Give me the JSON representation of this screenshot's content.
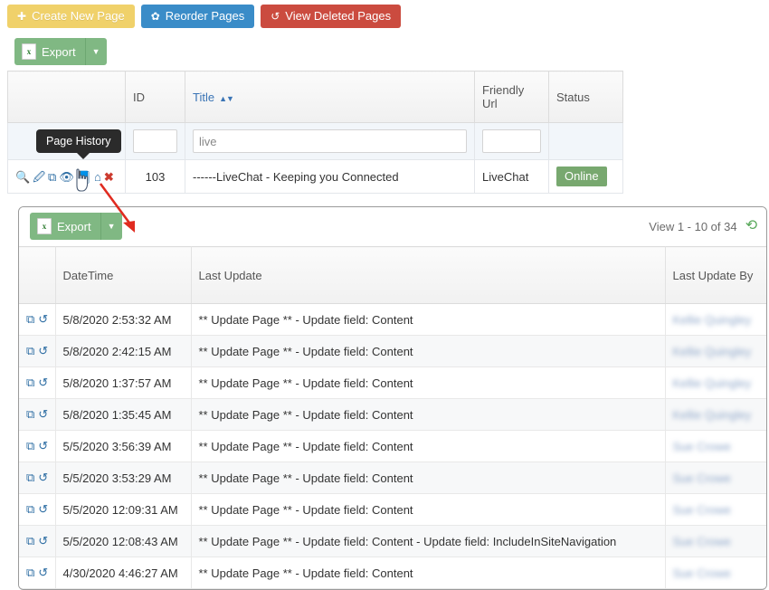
{
  "toolbar": {
    "create_label": "Create New Page",
    "create_icon": "plus-icon",
    "reorder_label": "Reorder Pages",
    "reorder_icon": "gear-icon",
    "deleted_label": "View Deleted Pages",
    "deleted_icon": "undo-icon"
  },
  "pages_panel": {
    "export_label": "Export",
    "export_icon_text": "x",
    "export_caret": "▼",
    "columns": [
      "",
      "ID",
      "Title",
      "Friendly Url",
      "Status"
    ],
    "title_sort_carets": "▲▼",
    "filters": {
      "id_value": "",
      "title_value": "live",
      "url_value": ""
    },
    "row": {
      "icons": [
        "search-icon",
        "edit-icon",
        "copy-icon",
        "preview-eye-icon",
        "page-history-icon",
        "home-icon",
        "delete-icon"
      ],
      "id": "103",
      "title": "------LiveChat - Keeping you Connected",
      "friendly_url": "LiveChat",
      "status": "Online"
    }
  },
  "tooltip": {
    "text": "Page History"
  },
  "history_panel": {
    "export_label": "Export",
    "export_icon_text": "x",
    "export_caret": "▼",
    "view_count": "View 1 - 10 of 34",
    "refresh_icon": "refresh-icon",
    "columns": [
      "",
      "DateTime",
      "Last Update",
      "Last Update By"
    ],
    "rows": [
      {
        "datetime": "5/8/2020 2:53:32 AM",
        "last_update": "** Update Page ** - Update field: Content",
        "last_update_by": "Kellie Quingley"
      },
      {
        "datetime": "5/8/2020 2:42:15 AM",
        "last_update": "** Update Page ** - Update field: Content",
        "last_update_by": "Kellie Quingley"
      },
      {
        "datetime": "5/8/2020 1:37:57 AM",
        "last_update": "** Update Page ** - Update field: Content",
        "last_update_by": "Kellie Quingley"
      },
      {
        "datetime": "5/8/2020 1:35:45 AM",
        "last_update": "** Update Page ** - Update field: Content",
        "last_update_by": "Kellie Quingley"
      },
      {
        "datetime": "5/5/2020 3:56:39 AM",
        "last_update": "** Update Page ** - Update field: Content",
        "last_update_by": "Sue Crowe"
      },
      {
        "datetime": "5/5/2020 3:53:29 AM",
        "last_update": "** Update Page ** - Update field: Content",
        "last_update_by": "Sue Crowe"
      },
      {
        "datetime": "5/5/2020 12:09:31 AM",
        "last_update": "** Update Page ** - Update field: Content",
        "last_update_by": "Sue Crowe"
      },
      {
        "datetime": "5/5/2020 12:08:43 AM",
        "last_update": "** Update Page ** - Update field: Content - Update field: IncludeInSiteNavigation",
        "last_update_by": "Sue Crowe"
      },
      {
        "datetime": "4/30/2020 4:46:27 AM",
        "last_update": "** Update Page ** - Update field: Content",
        "last_update_by": "Sue Crowe"
      }
    ],
    "row_icons": [
      "copy-icon",
      "restore-icon"
    ]
  },
  "annotation": {
    "arrow_color": "#e02b20"
  },
  "colors": {
    "warning": "#f0d16a",
    "primary": "#3a8cc8",
    "danger": "#cb4b3f",
    "success": "#80b883",
    "badge_online": "#78a86f",
    "link": "#3a74b5"
  }
}
